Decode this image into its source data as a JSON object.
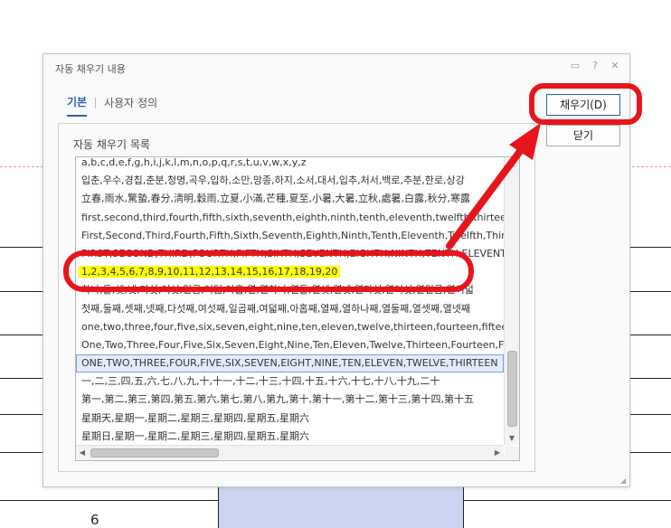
{
  "background": {
    "row_number": "6"
  },
  "dialog": {
    "title": "자동 채우기 내용",
    "title_icons": [
      "help-icon",
      "close-icon"
    ],
    "tabs": [
      {
        "label": "기본",
        "active": true
      },
      {
        "label": "사용자 정의",
        "active": false
      }
    ],
    "list_label": "자동 채우기 목록",
    "list_items": [
      "a,b,c,d,e,f,g,h,i,j,k,l,m,n,o,p,q,r,s,t,u,v,w,x,y,z",
      "입춘,우수,경칩,춘분,청명,곡우,입하,소만,망종,하지,소서,대서,입추,처서,백로,추분,한로,상강",
      "立春,雨水,驚蟄,春分,淸明,穀雨,立夏,小滿,芒種,夏至,小暑,大暑,立秋,處暑,白露,秋分,寒露",
      "first,second,third,fourth,fifth,sixth,seventh,eighth,ninth,tenth,eleventh,twelfth,thirteenth",
      "First,Second,Third,Fourth,Fifth,Sixth,Seventh,Eighth,Ninth,Tenth,Eleventh,Twelfth,Thirteenth",
      "FIRST,SECOND,THIRD,FOURTH,FIFTH,SIXTH,SEVENTH,EIGHTH,NINTH,TENTH,ELEVENTH",
      "1,2,3,4,5,6,7,8,9,10,11,12,13,14,15,16,17,18,19,20",
      "하나,둘,셋,넷,다섯,여섯,일곱,여덟,아홉,열,열하나,열둘,열셋,열넷,열다섯,열여섯,열일곱,열여덟",
      "첫째,둘째,셋째,넷째,다섯째,여섯째,일곱째,여덟째,아홉째,열째,열하나째,열둘째,열셋째,열넷째",
      "one,two,three,four,five,six,seven,eight,nine,ten,eleven,twelve,thirteen,fourteen,fifteen",
      "One,Two,Three,Four,Five,Six,Seven,Eight,Nine,Ten,Eleven,Twelve,Thirteen,Fourteen,Fifteen",
      "ONE,TWO,THREE,FOUR,FIVE,SIX,SEVEN,EIGHT,NINE,TEN,ELEVEN,TWELVE,THIRTEEN",
      "一,二,三,四,五,六,七,八,九,十,十一,十二,十三,十四,十五,十六,十七,十八,十九,二十",
      "第一,第二,第三,第四,第五,第六,第七,第八,第九,第十,第十一,第十二,第十三,第十四,第十五",
      "星期天,星期一,星期二,星期三,星期四,星期五,星期六",
      "星期日,星期一,星期二,星期三,星期四,星期五,星期六"
    ],
    "highlighted_index": 6,
    "selected_index": 11,
    "buttons": {
      "fill": "채우기(D)",
      "close": "닫기"
    }
  },
  "colors": {
    "annotation_red": "#e8141c",
    "highlight_yellow": "#ffff00",
    "accent_blue": "#2e5fb0"
  }
}
